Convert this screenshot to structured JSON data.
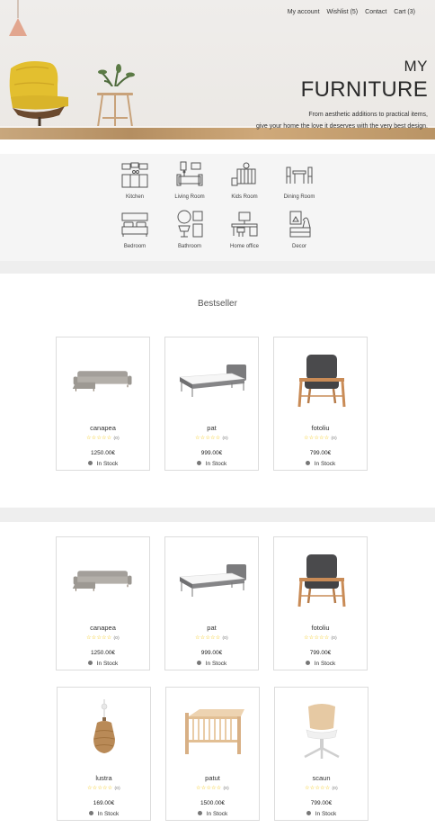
{
  "nav": {
    "account": "My account",
    "wishlist": "Wishlist (5)",
    "contact": "Contact",
    "cart": "Cart (3)"
  },
  "hero": {
    "brand_line1": "MY",
    "brand_line2": "FURNITURE",
    "tagline1": "From aesthetic additions to practical items,",
    "tagline2": "give your home the love it deserves with the very best design."
  },
  "categories": [
    {
      "label": "Kitchen",
      "icon": "kitchen-icon"
    },
    {
      "label": "Living Room",
      "icon": "living-room-icon"
    },
    {
      "label": "Kids Room",
      "icon": "kids-room-icon"
    },
    {
      "label": "Dining Room",
      "icon": "dining-room-icon"
    },
    {
      "label": "Bedroom",
      "icon": "bedroom-icon"
    },
    {
      "label": "Bathroom",
      "icon": "bathroom-icon"
    },
    {
      "label": "Home office",
      "icon": "home-office-icon"
    },
    {
      "label": "Decor",
      "icon": "decor-icon"
    }
  ],
  "bestseller": {
    "title": "Bestseller",
    "products": [
      {
        "name": "canapea",
        "price": "1250.00€",
        "stock": "In Stock",
        "rating_count": "(0)",
        "stars": "☆☆☆☆☆"
      },
      {
        "name": "pat",
        "price": "999.00€",
        "stock": "In Stock",
        "rating_count": "(0)",
        "stars": "☆☆☆☆☆"
      },
      {
        "name": "fotoliu",
        "price": "799.00€",
        "stock": "In Stock",
        "rating_count": "(0)",
        "stars": "☆☆☆☆☆"
      }
    ]
  },
  "catalog": {
    "products": [
      {
        "name": "canapea",
        "price": "1250.00€",
        "stock": "In Stock",
        "rating_count": "(0)",
        "stars": "☆☆☆☆☆"
      },
      {
        "name": "pat",
        "price": "999.00€",
        "stock": "In Stock",
        "rating_count": "(0)",
        "stars": "☆☆☆☆☆"
      },
      {
        "name": "fotoliu",
        "price": "799.00€",
        "stock": "In Stock",
        "rating_count": "(0)",
        "stars": "☆☆☆☆☆"
      },
      {
        "name": "lustra",
        "price": "169.00€",
        "stock": "In Stock",
        "rating_count": "(0)",
        "stars": "☆☆☆☆☆"
      },
      {
        "name": "patut",
        "price": "1500.00€",
        "stock": "In Stock",
        "rating_count": "(0)",
        "stars": "☆☆☆☆☆"
      },
      {
        "name": "scaun",
        "price": "799.00€",
        "stock": "In Stock",
        "rating_count": "(0)",
        "stars": "☆☆☆☆☆"
      }
    ]
  },
  "colors": {
    "star": "#f2c200",
    "stock_dot": "#777777",
    "band": "#f5f5f5"
  }
}
